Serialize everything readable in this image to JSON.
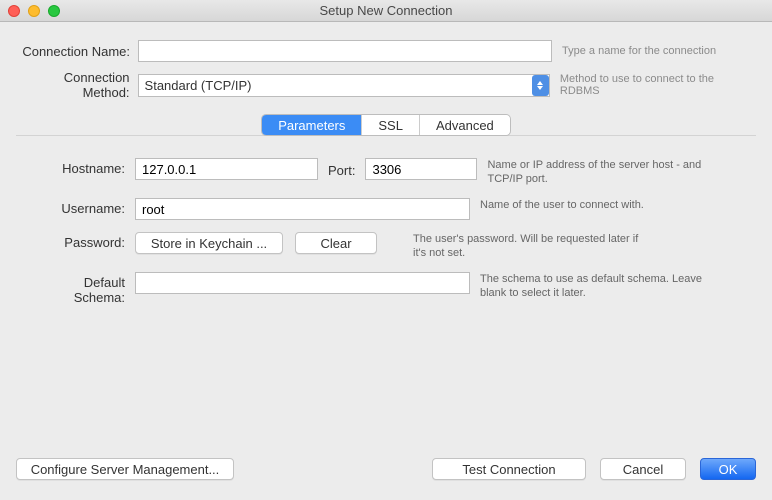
{
  "window": {
    "title": "Setup New Connection"
  },
  "top": {
    "connection_name_label": "Connection Name:",
    "connection_name_value": "",
    "connection_name_help": "Type a name for the connection",
    "connection_method_label": "Connection Method:",
    "connection_method_value": "Standard (TCP/IP)",
    "connection_method_help": "Method to use to connect to the RDBMS"
  },
  "tabs": {
    "items": [
      "Parameters",
      "SSL",
      "Advanced"
    ],
    "active_index": 0
  },
  "params": {
    "hostname_label": "Hostname:",
    "hostname_value": "127.0.0.1",
    "port_label": "Port:",
    "port_value": "3306",
    "hostname_help": "Name or IP address of the server host - and TCP/IP port.",
    "username_label": "Username:",
    "username_value": "root",
    "username_help": "Name of the user to connect with.",
    "password_label": "Password:",
    "keychain_button": "Store in Keychain ...",
    "clear_button": "Clear",
    "password_help": "The user's password. Will be requested later if it's not set.",
    "schema_label": "Default Schema:",
    "schema_value": "",
    "schema_help": "The schema to use as default schema. Leave blank to select it later."
  },
  "footer": {
    "configure": "Configure Server Management...",
    "test": "Test Connection",
    "cancel": "Cancel",
    "ok": "OK"
  }
}
